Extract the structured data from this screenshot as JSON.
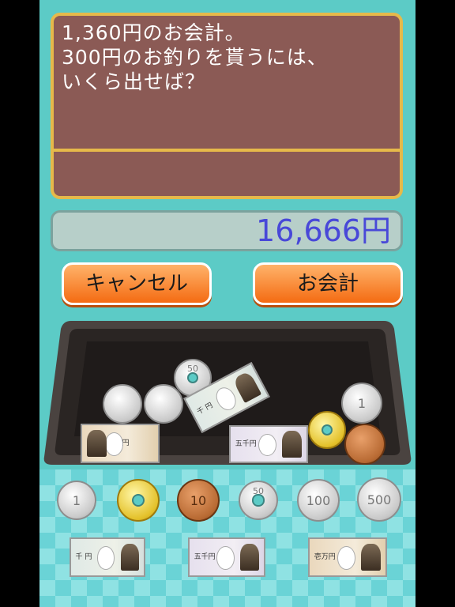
{
  "question": {
    "text": "1,360円のお会計。\n300円のお釣りを貰うには、\nいくら出せば？",
    "answer": ""
  },
  "amount_display": "16,666円",
  "buttons": {
    "cancel": "キャンセル",
    "pay": "お会計"
  },
  "tray_money": {
    "coin_1": "1",
    "coin_50": "50",
    "bill_1000_label": "千 円",
    "bill_5000_label": "五千円",
    "bill_10000_label": "壱万円"
  },
  "palette": {
    "coins": [
      {
        "name": "coin-1-yen",
        "label": "1"
      },
      {
        "name": "coin-5-yen",
        "label": ""
      },
      {
        "name": "coin-10-yen",
        "label": "10"
      },
      {
        "name": "coin-50-yen",
        "label": "50"
      },
      {
        "name": "coin-100-yen",
        "label": "100"
      },
      {
        "name": "coin-500-yen",
        "label": "500"
      }
    ],
    "bills": [
      {
        "name": "bill-1000-yen",
        "label": "千 円"
      },
      {
        "name": "bill-5000-yen",
        "label": "五千円"
      },
      {
        "name": "bill-10000-yen",
        "label": "壱万円"
      }
    ]
  },
  "colors": {
    "background": "#5ccbc6",
    "question_box": "#8b5a55",
    "question_border": "#e6b94a",
    "amount_text": "#4848d8",
    "button": "#f46b12"
  }
}
